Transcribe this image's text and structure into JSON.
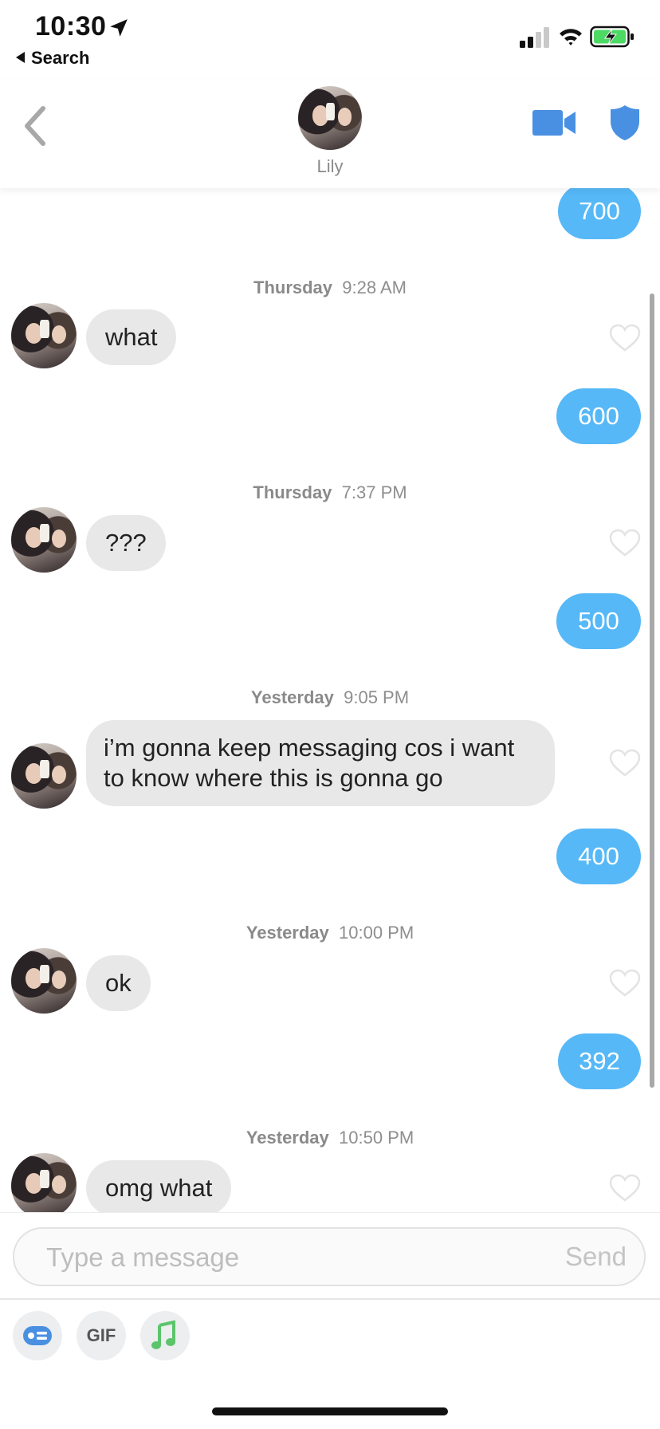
{
  "status_bar": {
    "time": "10:30",
    "back_app_label": "Search"
  },
  "header": {
    "contact_name": "Lily"
  },
  "thread": [
    {
      "type": "me",
      "text": "700"
    },
    {
      "type": "timestamp",
      "day": "Thursday",
      "time": "9:28 AM"
    },
    {
      "type": "them",
      "text": "what"
    },
    {
      "type": "me",
      "text": "600"
    },
    {
      "type": "timestamp",
      "day": "Thursday",
      "time": "7:37 PM"
    },
    {
      "type": "them",
      "text": "???"
    },
    {
      "type": "me",
      "text": "500"
    },
    {
      "type": "timestamp",
      "day": "Yesterday",
      "time": "9:05 PM"
    },
    {
      "type": "them",
      "text": "i’m gonna keep messaging cos i want to know where this is gonna go"
    },
    {
      "type": "me",
      "text": "400"
    },
    {
      "type": "timestamp",
      "day": "Yesterday",
      "time": "10:00 PM"
    },
    {
      "type": "them",
      "text": "ok"
    },
    {
      "type": "me",
      "text": "392"
    },
    {
      "type": "timestamp",
      "day": "Yesterday",
      "time": "10:50 PM"
    },
    {
      "type": "them",
      "text": "omg what"
    }
  ],
  "composer": {
    "placeholder": "Type a message",
    "send_label": "Send"
  },
  "toolbar": {
    "gif_label": "GIF"
  },
  "colors": {
    "accent": "#56b8f7",
    "incoming_bubble": "#e8e8e8",
    "brand_blue": "#4a90e2",
    "music_green": "#5cc46b"
  },
  "icons": [
    "location-arrow-icon",
    "signal-icon",
    "wifi-icon",
    "battery-charging-icon",
    "back-chevron-icon",
    "video-call-icon",
    "shield-icon",
    "heart-icon",
    "contact-card-icon",
    "music-note-icon"
  ]
}
